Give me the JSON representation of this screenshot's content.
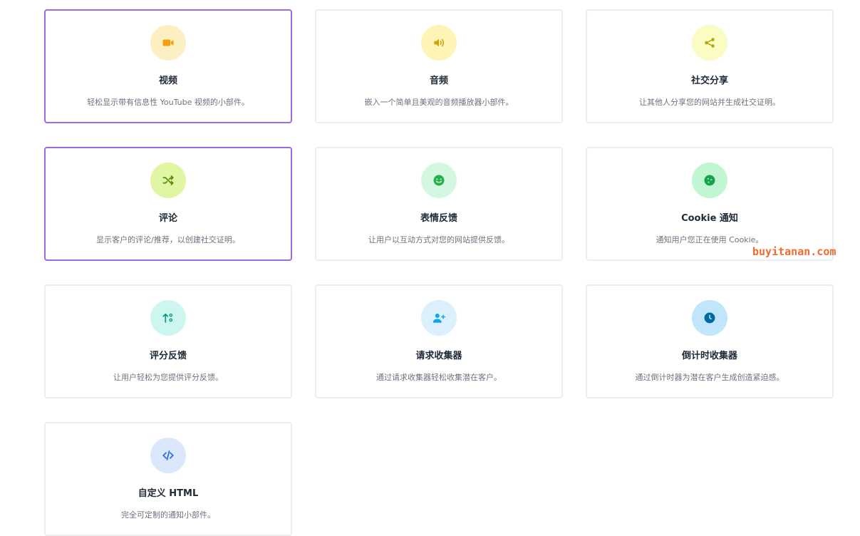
{
  "widgets": [
    {
      "title": "视频",
      "description": "轻松显示带有信息性 YouTube 视频的小部件。",
      "icon": "video-icon",
      "icon_color": "#f59e0b",
      "bg_color": "#fdefc4",
      "selected": true
    },
    {
      "title": "音频",
      "description": "嵌入一个简单且美观的音频播放器小部件。",
      "icon": "audio-icon",
      "icon_color": "#d4a106",
      "bg_color": "#fdf4b6",
      "selected": false
    },
    {
      "title": "社交分享",
      "description": "让其他人分享您的网站并生成社交证明。",
      "icon": "share-icon",
      "icon_color": "#b8a406",
      "bg_color": "#fbfbc4",
      "selected": false
    },
    {
      "title": "评论",
      "description": "显示客户的评论/推荐，以创建社交证明。",
      "icon": "shuffle-icon",
      "icon_color": "#5a8a0f",
      "bg_color": "#e0f6a2",
      "selected": true
    },
    {
      "title": "表情反馈",
      "description": "让用户以互动方式对您的网站提供反馈。",
      "icon": "smile-icon",
      "icon_color": "#22b14c",
      "bg_color": "#d4f8df",
      "selected": false
    },
    {
      "title": "Cookie 通知",
      "description": "通知用户您正在使用 Cookie。",
      "icon": "cookie-icon",
      "icon_color": "#16a34a",
      "bg_color": "#c2f5d2",
      "selected": false
    },
    {
      "title": "评分反馈",
      "description": "让用户轻松为您提供评分反馈。",
      "icon": "sort-icon",
      "icon_color": "#0d9488",
      "bg_color": "#cdf7ee",
      "selected": false
    },
    {
      "title": "请求收集器",
      "description": "通过请求收集器轻松收集潜在客户。",
      "icon": "user-plus-icon",
      "icon_color": "#0ea5e9",
      "bg_color": "#dcf0fb",
      "selected": false
    },
    {
      "title": "倒计时收集器",
      "description": "通过倒计时器为潜在客户生成创造紧迫感。",
      "icon": "clock-icon",
      "icon_color": "#0369a1",
      "bg_color": "#bfe6fb",
      "selected": false
    },
    {
      "title": "自定义 HTML",
      "description": "完全可定制的通知小部件。",
      "icon": "code-icon",
      "icon_color": "#2563eb",
      "bg_color": "#dbe8fc",
      "selected": false
    }
  ],
  "watermark": "buyitanan.com"
}
